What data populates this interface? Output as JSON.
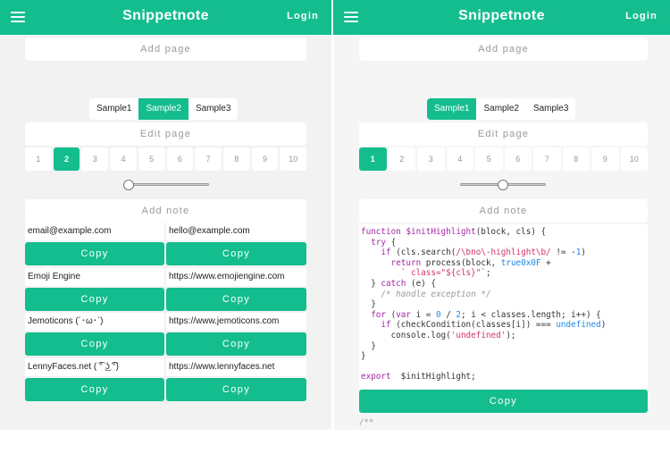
{
  "app": {
    "title": "Snippetnote",
    "login_label": "Login"
  },
  "colors": {
    "accent": "#14bd8e",
    "background": "#f2f2f2"
  },
  "icons": {
    "menu": "hamburger-menu-icon"
  },
  "left": {
    "add_page": "Add page",
    "samples": [
      "Sample1",
      "Sample2",
      "Sample3"
    ],
    "active_sample": "Sample2",
    "edit_page": "Edit page",
    "pages": [
      "1",
      "2",
      "3",
      "4",
      "5",
      "6",
      "7",
      "8",
      "9",
      "10"
    ],
    "active_page": "2",
    "slider_level": 0,
    "add_note": "Add note",
    "copy_label": "Copy",
    "notes": [
      {
        "a": "email@example.com",
        "b": "hello@example.com"
      },
      {
        "a": "Emoji Engine",
        "b": "https://www.emojiengine.com"
      },
      {
        "a": "Jemoticons (´･ω･`)",
        "b": "https://www.jemoticons.com"
      },
      {
        "a": "LennyFaces.net ( ͡° ͜ʖ ͡°)",
        "b": "https://www.lennyfaces.net"
      }
    ]
  },
  "right": {
    "add_page": "Add page",
    "samples": [
      "Sample1",
      "Sample2",
      "Sample3"
    ],
    "active_sample": "Sample1",
    "edit_page": "Edit page",
    "pages": [
      "1",
      "2",
      "3",
      "4",
      "5",
      "6",
      "7",
      "8",
      "9",
      "10"
    ],
    "active_page": "1",
    "slider_level": 0.5,
    "add_note": "Add note",
    "copy_label": "Copy",
    "code_lines": [
      [
        [
          "kw",
          "function "
        ],
        [
          "fn",
          "$initHighlight"
        ],
        [
          "",
          "(block, cls) {"
        ]
      ],
      [
        [
          "",
          "  "
        ],
        [
          "kw",
          "try"
        ],
        [
          "",
          " {"
        ]
      ],
      [
        [
          "",
          "    "
        ],
        [
          "kw",
          "if"
        ],
        [
          "",
          " (cls.search("
        ],
        [
          "str",
          "/\\bno\\-highlight\\b/"
        ],
        [
          "",
          " != -"
        ],
        [
          "num",
          "1"
        ],
        [
          "",
          ")"
        ]
      ],
      [
        [
          "",
          "      "
        ],
        [
          "kw",
          "return"
        ],
        [
          "",
          " process(block, "
        ],
        [
          "lit",
          "true"
        ],
        [
          ", "
        ],
        [
          "num",
          "0x0F"
        ],
        [
          "",
          " +"
        ]
      ],
      [
        [
          "",
          "        "
        ],
        [
          "str",
          "` class=\"${cls}\"`"
        ],
        [
          "",
          ";"
        ]
      ],
      [
        [
          "",
          "  } "
        ],
        [
          "kw",
          "catch"
        ],
        [
          "",
          " (e) {"
        ]
      ],
      [
        [
          "",
          "    "
        ],
        [
          "cm",
          "/* handle exception */"
        ]
      ],
      [
        [
          "",
          "  }"
        ]
      ],
      [
        [
          "",
          "  "
        ],
        [
          "kw",
          "for"
        ],
        [
          "",
          " ("
        ],
        [
          "kw",
          "var"
        ],
        [
          "",
          " i = "
        ],
        [
          "num",
          "0"
        ],
        [
          "",
          " / "
        ],
        [
          "num",
          "2"
        ],
        [
          "",
          "; i < classes.length; i++) {"
        ]
      ],
      [
        [
          "",
          "    "
        ],
        [
          "kw",
          "if"
        ],
        [
          "",
          " (checkCondition(classes[i]) === "
        ],
        [
          "lit",
          "undefined"
        ],
        [
          "",
          ")"
        ]
      ],
      [
        [
          "",
          "      console.log("
        ],
        [
          "str",
          "'undefined'"
        ],
        [
          "",
          ");"
        ]
      ],
      [
        [
          "",
          "  }"
        ]
      ],
      [
        [
          "",
          "}"
        ]
      ],
      [
        [
          "",
          ""
        ]
      ],
      [
        [
          "kw",
          "export"
        ],
        [
          "",
          "  $initHighlight;"
        ]
      ]
    ],
    "code_tail": "/**"
  }
}
